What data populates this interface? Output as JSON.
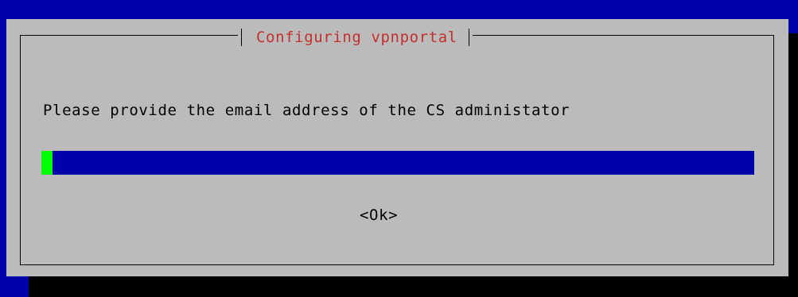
{
  "dialog": {
    "title": "Configuring vpnportal",
    "prompt": "Please provide the email address of the CS administator",
    "input": {
      "value": ""
    },
    "ok_label": "<Ok>"
  },
  "colors": {
    "background": "#0000aa",
    "dialog": "#bbbbbb",
    "title": "#c43030",
    "cursor": "#00ff00",
    "shadow": "#000000"
  }
}
